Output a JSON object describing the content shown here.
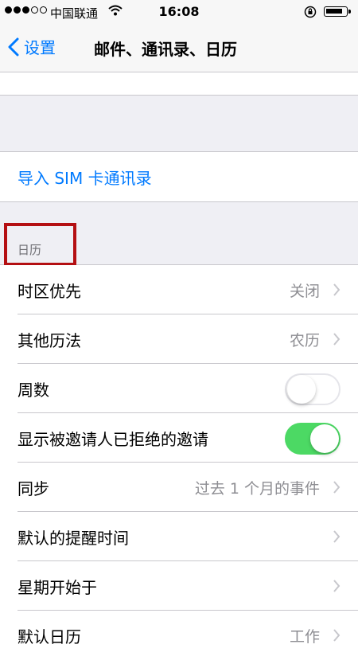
{
  "status_bar": {
    "carrier": "中国联通",
    "time": "16:08"
  },
  "nav": {
    "back_label": "设置",
    "title": "邮件、通讯录、日历"
  },
  "contacts": {
    "import_sim": "导入 SIM 卡通讯录"
  },
  "calendar": {
    "header": "日历",
    "rows": [
      {
        "label": "时区优先",
        "value": "关闭"
      },
      {
        "label": "其他历法",
        "value": "农历"
      },
      {
        "label": "周数"
      },
      {
        "label": "显示被邀请人已拒绝的邀请"
      },
      {
        "label": "同步",
        "value": "过去 1 个月的事件"
      },
      {
        "label": "默认的提醒时间"
      },
      {
        "label": "星期开始于"
      },
      {
        "label": "默认日历",
        "value": "工作"
      }
    ],
    "week_numbers_on": false,
    "show_declined_on": true
  },
  "colors": {
    "accent": "#007aff",
    "toggle_on": "#4cd964",
    "highlight": "#b40f12"
  }
}
